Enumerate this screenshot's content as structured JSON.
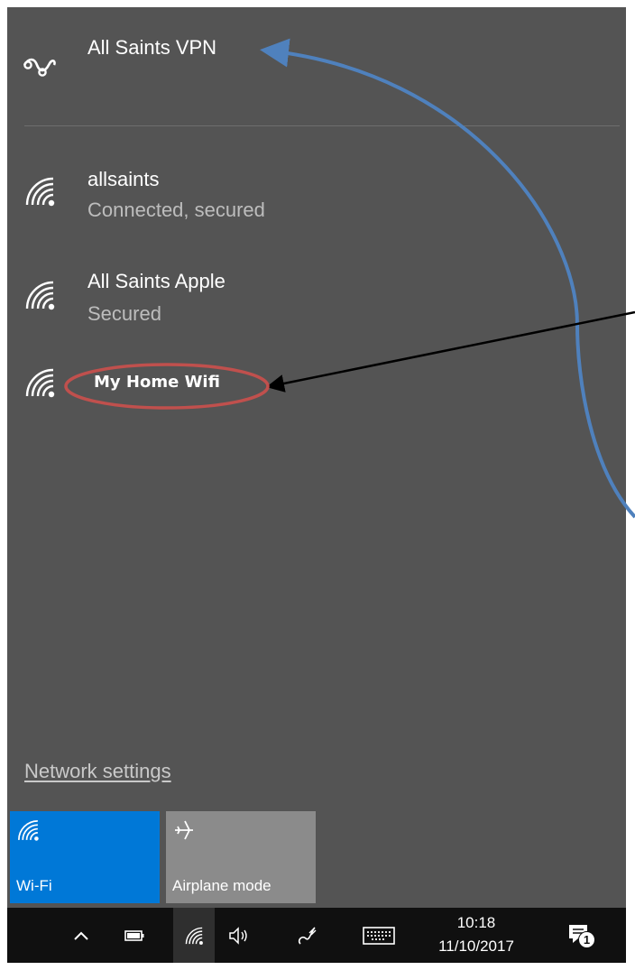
{
  "vpn": {
    "name": "All Saints VPN",
    "icon": "vpn-icon"
  },
  "networks": [
    {
      "name": "allsaints",
      "status": "Connected, secured",
      "icon": "wifi-signal-icon"
    },
    {
      "name": "All Saints Apple",
      "status": "Secured",
      "icon": "wifi-signal-icon"
    },
    {
      "name": "",
      "status": "",
      "icon": "wifi-signal-icon"
    }
  ],
  "network_settings_label": "Network settings",
  "quick_actions": [
    {
      "label": "Wi-Fi",
      "icon": "wifi-icon",
      "active": true,
      "color": "#0078d7"
    },
    {
      "label": "Airplane mode",
      "icon": "airplane-icon",
      "active": false,
      "color": "#8b8b8b"
    }
  ],
  "taskbar": {
    "time": "10:18",
    "date": "11/10/2017",
    "notification_count": "1",
    "icons": [
      "chevron-up-icon",
      "battery-icon",
      "wifi-icon",
      "volume-icon",
      "pen-icon",
      "keyboard-icon",
      "action-center-icon"
    ]
  },
  "annotation": {
    "highlight_label": "My Home Wifi",
    "ellipse_color": "#c0504d",
    "blue_arrow_color": "#4f81bd",
    "black_arrow_color": "#000000"
  },
  "colors": {
    "flyout_bg": "#545454",
    "taskbar_bg": "#101010",
    "accent": "#0078d7"
  }
}
